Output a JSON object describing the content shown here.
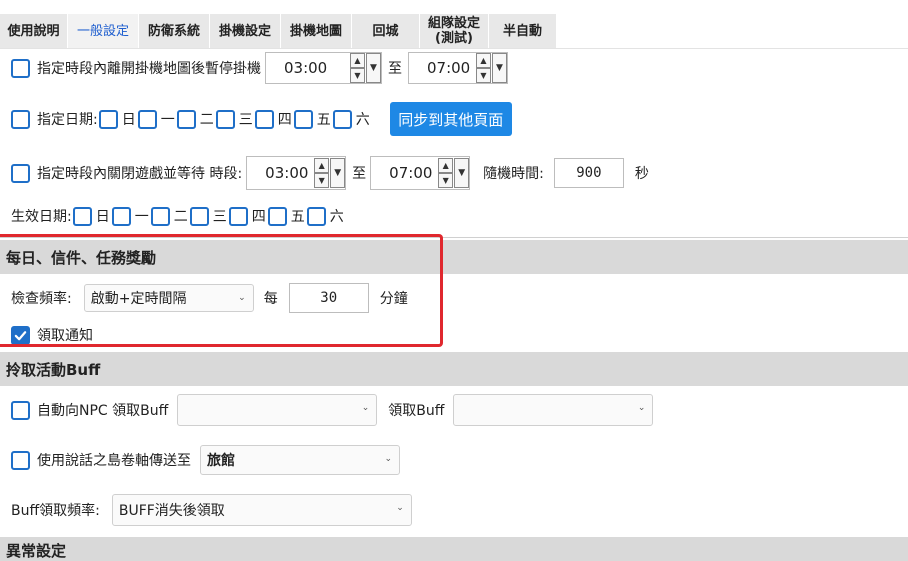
{
  "tabs": [
    {
      "label": "使用說明"
    },
    {
      "label": "一般設定"
    },
    {
      "label": "防衛系統"
    },
    {
      "label": "掛機設定"
    },
    {
      "label": "掛機地圖"
    },
    {
      "label": "回城"
    },
    {
      "label": "組隊設定\n(測試)"
    },
    {
      "label": "半自動"
    }
  ],
  "leave_map": {
    "label": "指定時段內離開掛機地圖後暫停掛機",
    "start": "03:00",
    "to": "至",
    "end": "07:00"
  },
  "dates": {
    "label": "指定日期:",
    "days": [
      "日",
      "一",
      "二",
      "三",
      "四",
      "五",
      "六"
    ],
    "sync_button": "同步到其他頁面"
  },
  "close_game": {
    "label": "指定時段內關閉遊戲並等待 時段:",
    "start": "03:00",
    "to": "至",
    "end": "07:00",
    "random_label": "隨機時間:",
    "random_value": "900",
    "unit": "秒"
  },
  "effective": {
    "label": "生效日期:",
    "days": [
      "日",
      "一",
      "二",
      "三",
      "四",
      "五",
      "六"
    ]
  },
  "daily": {
    "title": "每日、信件、任務獎勵",
    "freq_label": "檢查頻率:",
    "freq_value": "啟動+定時間隔",
    "every": "每",
    "minutes": "30",
    "unit": "分鐘",
    "notify_label": "領取通知",
    "notify_checked": true
  },
  "buff": {
    "title": "拎取活動Buff",
    "npc_label": "自動向NPC 領取Buff",
    "npc_value": "",
    "get_label": "領取Buff",
    "get_value": "",
    "scroll_label": "使用說話之島卷軸傳送至",
    "scroll_value": "旅館",
    "freq_label": "Buff領取頻率:",
    "freq_value": "BUFF消失後領取"
  },
  "abnormal": {
    "title": "異常設定"
  },
  "colors": {
    "accent": "#1e88e5",
    "checkbox": "#1f6fc8",
    "highlight": "#e0282e",
    "section_bg": "#d9d9d9"
  }
}
